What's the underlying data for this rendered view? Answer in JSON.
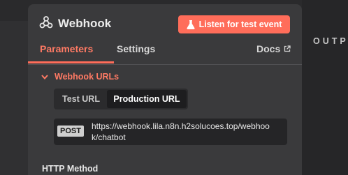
{
  "panel": {
    "title": "Webhook",
    "listen_button": "Listen for test event",
    "icons": {
      "logo": "webhook-icon",
      "listen": "flask-icon",
      "docs": "external-link-icon",
      "section": "chevron-down-icon"
    }
  },
  "tabs": {
    "parameters": "Parameters",
    "settings": "Settings",
    "docs": "Docs"
  },
  "section": {
    "title": "Webhook URLs",
    "url_tabs": [
      "Test URL",
      "Production URL"
    ],
    "selected_url_tab": "Production URL",
    "method": "POST",
    "url_line1": "https://webhook.lila.n8n.h2solucoes.top/webhoo",
    "url_line2": "k/chatbot"
  },
  "field": {
    "http_method_label": "HTTP Method"
  },
  "output": {
    "label": "OUTP"
  },
  "colors": {
    "accent": "#ff6d5a",
    "panel_bg": "#3a3a3c",
    "page_bg": "#1f1f20"
  }
}
